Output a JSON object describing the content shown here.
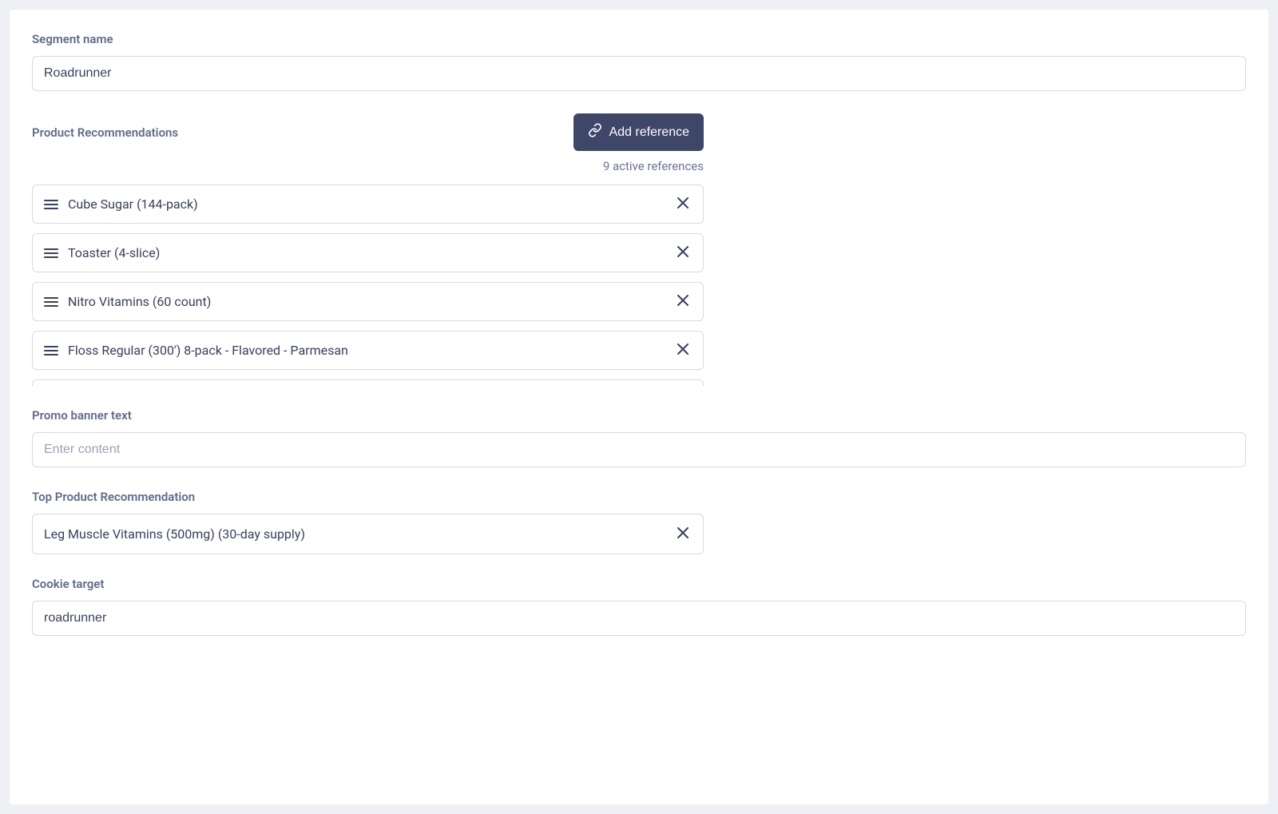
{
  "segment": {
    "label": "Segment name",
    "value": "Roadrunner"
  },
  "recommendations": {
    "label": "Product Recommendations",
    "add_button_label": "Add reference",
    "active_count_text": "9 active references",
    "items": [
      {
        "title": "Cube Sugar (144-pack)"
      },
      {
        "title": "Toaster (4-slice)"
      },
      {
        "title": "Nitro Vitamins (60 count)"
      },
      {
        "title": "Floss Regular (300') 8-pack - Flavored - Parmesan"
      }
    ]
  },
  "promo": {
    "label": "Promo banner text",
    "placeholder": "Enter content",
    "value": ""
  },
  "top_recommendation": {
    "label": "Top Product Recommendation",
    "item_title": "Leg Muscle Vitamins (500mg) (30-day supply)"
  },
  "cookie": {
    "label": "Cookie target",
    "value": "roadrunner"
  }
}
